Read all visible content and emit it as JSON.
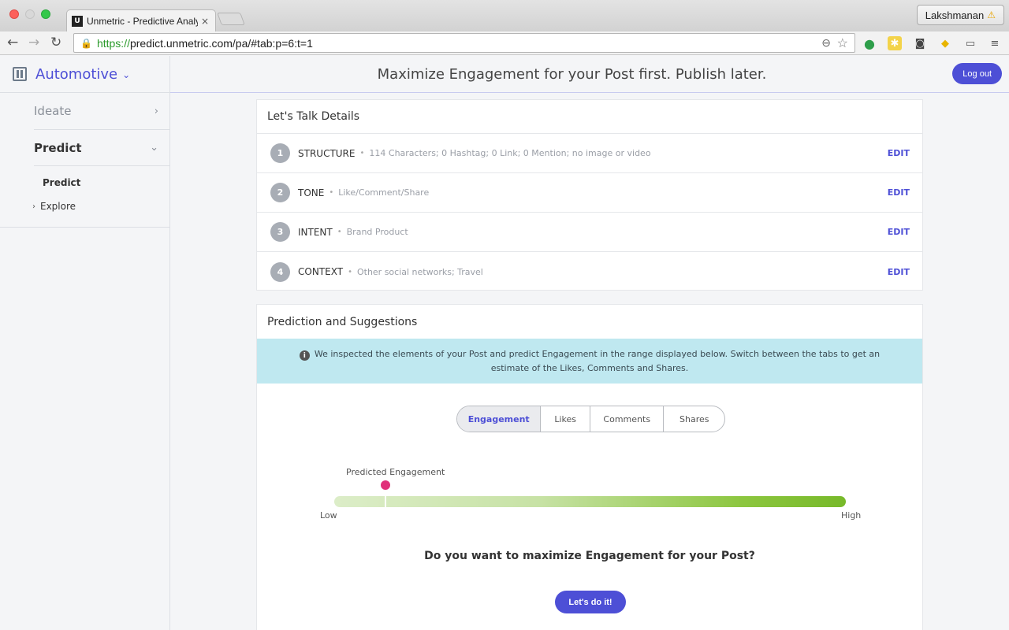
{
  "browser": {
    "tab_title": "Unmetric - Predictive Analy",
    "tab_favicon": "U",
    "tab_close": "×",
    "profile_name": "Lakshmanan",
    "url_scheme": "https://",
    "url_rest": "predict.unmetric.com/pa/#tab:p=6:t=1",
    "icons": [
      "back-arrow-icon",
      "forward-arrow-icon",
      "reload-icon",
      "lock-icon",
      "zoom-icon",
      "star-icon",
      "menu-icon"
    ]
  },
  "sidebar": {
    "brand": "Automotive",
    "items": [
      {
        "label": "Ideate"
      },
      {
        "label": "Predict"
      }
    ],
    "subitems": [
      {
        "label": "Predict"
      },
      {
        "label": "Explore"
      }
    ]
  },
  "header": {
    "title": "Maximize Engagement for your Post first. Publish later.",
    "logout_label": "Log out"
  },
  "details": {
    "title": "Let's Talk Details",
    "edit_label": "EDIT",
    "rows": [
      {
        "num": "1",
        "label": "STRUCTURE",
        "value": "114 Characters; 0 Hashtag; 0 Link; 0 Mention; no image or video"
      },
      {
        "num": "2",
        "label": "TONE",
        "value": "Like/Comment/Share"
      },
      {
        "num": "3",
        "label": "INTENT",
        "value": "Brand Product"
      },
      {
        "num": "4",
        "label": "CONTEXT",
        "value": "Other social networks; Travel"
      }
    ]
  },
  "prediction": {
    "title": "Prediction and Suggestions",
    "info": "We inspected the elements of your Post and predict Engagement in the range displayed below. Switch between the tabs to get an estimate of the Likes, Comments and Shares.",
    "tabs": [
      {
        "label": "Engagement",
        "active": true
      },
      {
        "label": "Likes"
      },
      {
        "label": "Comments"
      },
      {
        "label": "Shares"
      }
    ],
    "gauge_label": "Predicted Engagement",
    "gauge_level": 0.1,
    "low_label": "Low",
    "high_label": "High",
    "question": "Do you want to maximize Engagement for your Post?",
    "cta_label": "Let's do it!"
  },
  "colors": {
    "accent": "#4d4fd6",
    "marker": "#e0317a",
    "banner": "#bfe8f0"
  }
}
